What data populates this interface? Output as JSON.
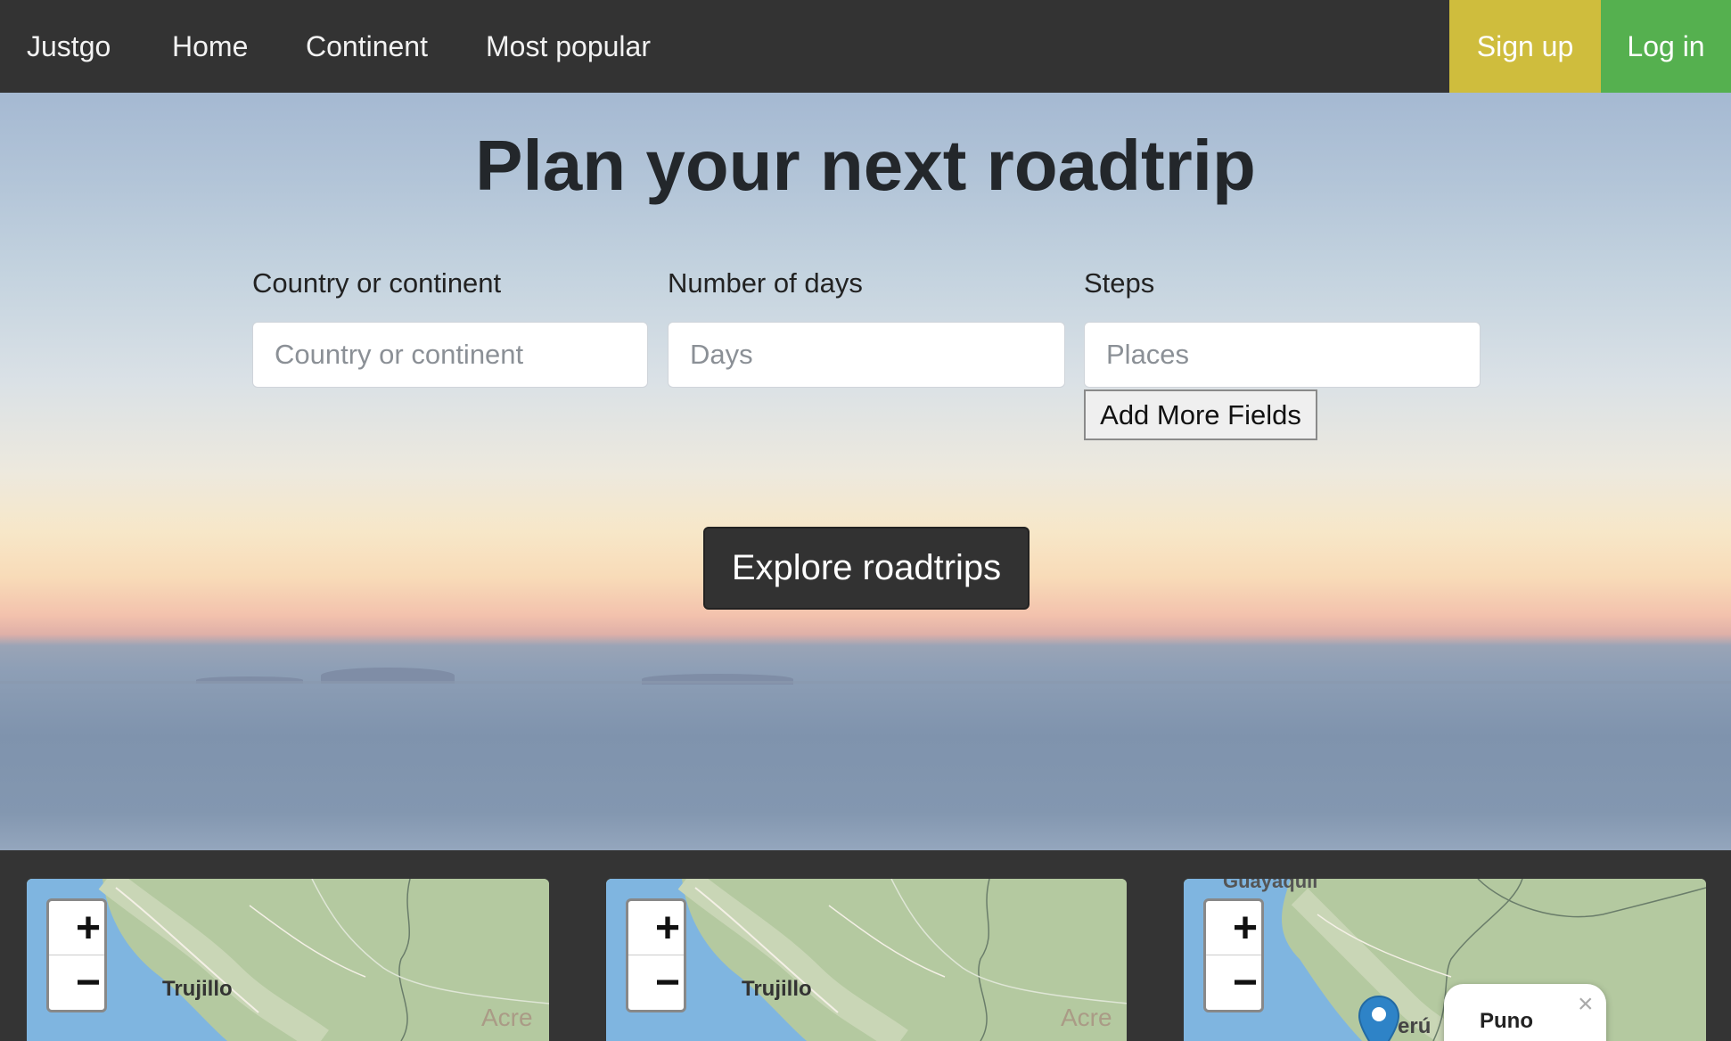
{
  "navbar": {
    "brand": "Justgo",
    "links": [
      "Home",
      "Continent",
      "Most popular"
    ],
    "signup_label": "Sign up",
    "login_label": "Log in"
  },
  "hero": {
    "title": "Plan your next roadtrip",
    "fields": {
      "country": {
        "label": "Country or continent",
        "placeholder": "Country or continent",
        "value": ""
      },
      "days": {
        "label": "Number of days",
        "placeholder": "Days",
        "value": ""
      },
      "steps": {
        "label": "Steps",
        "placeholder": "Places",
        "value": ""
      }
    },
    "add_more_label": "Add More Fields",
    "explore_label": "Explore roadtrips"
  },
  "maps": [
    {
      "zoom_in": "+",
      "zoom_out": "−",
      "city": "Trujillo",
      "region": "Acre"
    },
    {
      "zoom_in": "+",
      "zoom_out": "−",
      "city": "Trujillo",
      "region": "Acre"
    },
    {
      "zoom_in": "+",
      "zoom_out": "−",
      "top_city": "Guayaquil",
      "country": "erú",
      "popup": {
        "title": "Puno",
        "close": "×"
      }
    }
  ],
  "colors": {
    "navbar": "#333333",
    "signup": "#cfbd3d",
    "login": "#55b04f",
    "explore_button": "#323232",
    "map_water": "#7fb5e0",
    "map_land": "#b4c9a0"
  }
}
